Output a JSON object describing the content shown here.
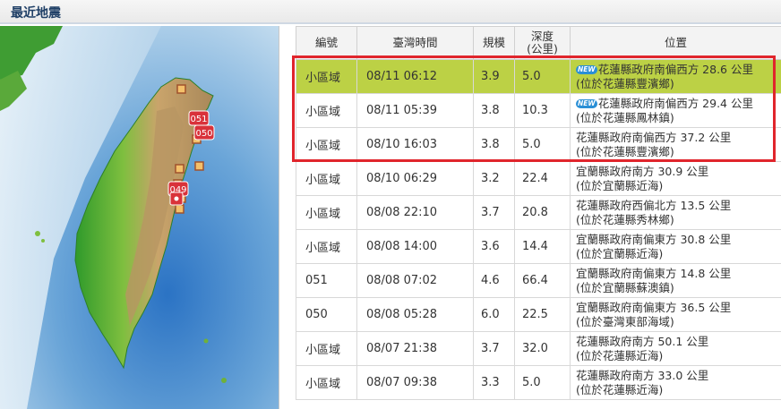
{
  "header": {
    "title": "最近地震"
  },
  "table": {
    "columns": {
      "id": "編號",
      "time": "臺灣時間",
      "magnitude": "規模",
      "depth_line1": "深度",
      "depth_line2": "(公里)",
      "location": "位置"
    },
    "rows": [
      {
        "id": "小區域",
        "time": "08/11 06:12",
        "magnitude": "3.9",
        "depth": "5.0",
        "new": "NEW",
        "loc1": "花蓮縣政府南偏西方 28.6 公里",
        "loc2": "(位於花蓮縣豐濱鄉)"
      },
      {
        "id": "小區域",
        "time": "08/11 05:39",
        "magnitude": "3.8",
        "depth": "10.3",
        "new": "NEW",
        "loc1": "花蓮縣政府南偏西方 29.4 公里",
        "loc2": "(位於花蓮縣鳳林鎮)"
      },
      {
        "id": "小區域",
        "time": "08/10 16:03",
        "magnitude": "3.8",
        "depth": "5.0",
        "new": "",
        "loc1": "花蓮縣政府南偏西方 37.2 公里",
        "loc2": "(位於花蓮縣豐濱鄉)"
      },
      {
        "id": "小區域",
        "time": "08/10 06:29",
        "magnitude": "3.2",
        "depth": "22.4",
        "new": "",
        "loc1": "宜蘭縣政府南方 30.9 公里",
        "loc2": "(位於宜蘭縣近海)"
      },
      {
        "id": "小區域",
        "time": "08/08 22:10",
        "magnitude": "3.7",
        "depth": "20.8",
        "new": "",
        "loc1": "花蓮縣政府西偏北方 13.5 公里",
        "loc2": "(位於花蓮縣秀林鄉)"
      },
      {
        "id": "小區域",
        "time": "08/08 14:00",
        "magnitude": "3.6",
        "depth": "14.4",
        "new": "",
        "loc1": "宜蘭縣政府南偏東方 30.8 公里",
        "loc2": "(位於宜蘭縣近海)"
      },
      {
        "id": "051",
        "time": "08/08 07:02",
        "magnitude": "4.6",
        "depth": "66.4",
        "new": "",
        "loc1": "宜蘭縣政府南偏東方 14.8 公里",
        "loc2": "(位於宜蘭縣蘇澳鎮)"
      },
      {
        "id": "050",
        "time": "08/08 05:28",
        "magnitude": "6.0",
        "depth": "22.5",
        "new": "",
        "loc1": "宜蘭縣政府南偏東方 36.5 公里",
        "loc2": "(位於臺灣東部海域)"
      },
      {
        "id": "小區域",
        "time": "08/07 21:38",
        "magnitude": "3.7",
        "depth": "32.0",
        "new": "",
        "loc1": "花蓮縣政府南方 50.1 公里",
        "loc2": "(位於花蓮縣近海)"
      },
      {
        "id": "小區域",
        "time": "08/07 09:38",
        "magnitude": "3.3",
        "depth": "5.0",
        "new": "",
        "loc1": "花蓮縣政府南方 33.0 公里",
        "loc2": "(位於花蓮縣近海)"
      }
    ]
  },
  "map": {
    "markers": [
      {
        "label": "051",
        "name": "marker-051"
      },
      {
        "label": "050",
        "name": "marker-050"
      },
      {
        "label": "049",
        "name": "marker-049"
      }
    ]
  },
  "colors": {
    "highlight_row": "#bcd145",
    "selection_box": "#e0252c",
    "header_title": "#1f3f66",
    "new_badge": "#2a8fd6"
  }
}
